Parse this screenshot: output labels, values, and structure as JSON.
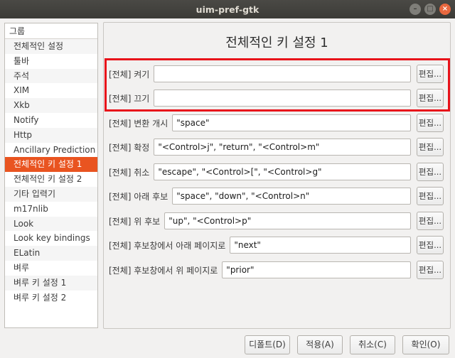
{
  "window": {
    "title": "uim-pref-gtk"
  },
  "sidebar": {
    "header": "그룹",
    "items": [
      {
        "label": "전체적인 설정"
      },
      {
        "label": "툴바"
      },
      {
        "label": "주석"
      },
      {
        "label": "XIM"
      },
      {
        "label": "Xkb"
      },
      {
        "label": "Notify"
      },
      {
        "label": "Http"
      },
      {
        "label": "Ancillary Prediction"
      },
      {
        "label": "전체적인 키 설정 1",
        "selected": true
      },
      {
        "label": "전체적인 키 설정 2"
      },
      {
        "label": "기타 입력기"
      },
      {
        "label": "m17nlib"
      },
      {
        "label": "Look"
      },
      {
        "label": "Look key bindings"
      },
      {
        "label": "ELatin"
      },
      {
        "label": "벼루"
      },
      {
        "label": "벼루 키 설정 1"
      },
      {
        "label": "벼루 키 설정 2"
      }
    ]
  },
  "main": {
    "title": "전체적인 키 설정 1",
    "edit_label": "편집...",
    "rows": [
      {
        "label": "[전체] 켜기",
        "value": ""
      },
      {
        "label": "[전체] 끄기",
        "value": ""
      },
      {
        "label": "[전체] 변환 개시",
        "value": "\"space\""
      },
      {
        "label": "[전체] 확정",
        "value": "\"<Control>j\", \"return\", \"<Control>m\""
      },
      {
        "label": "[전체] 취소",
        "value": "\"escape\", \"<Control>[\", \"<Control>g\""
      },
      {
        "label": "[전체] 아래 후보",
        "value": "\"space\", \"down\", \"<Control>n\""
      },
      {
        "label": "[전체] 위 후보",
        "value": "\"up\", \"<Control>p\""
      },
      {
        "label": "[전체] 후보창에서 아래 페이지로",
        "value": "\"next\""
      },
      {
        "label": "[전체] 후보창에서 위 페이지로",
        "value": "\"prior\""
      }
    ]
  },
  "footer": {
    "defaults_label": "디폴트(D)",
    "apply_label": "적용(A)",
    "cancel_label": "취소(C)",
    "ok_label": "확인(O)"
  },
  "colors": {
    "accent": "#e95420",
    "highlight_border": "#e8121a"
  }
}
